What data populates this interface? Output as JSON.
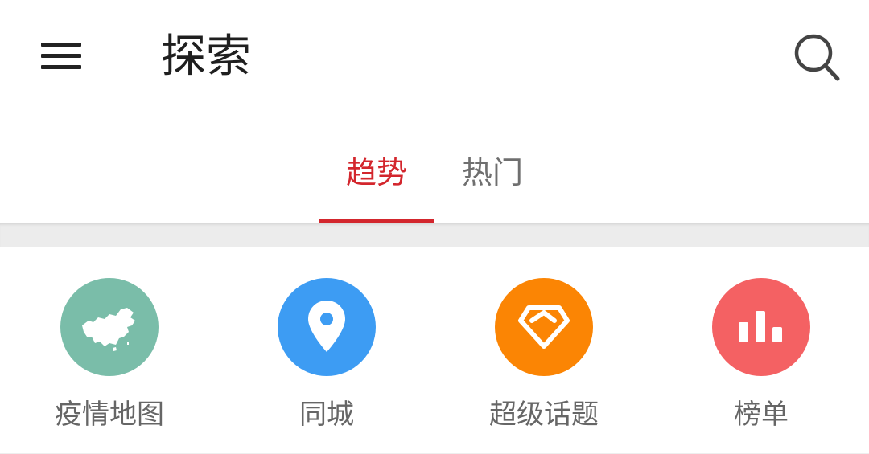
{
  "header": {
    "title": "探索",
    "menu_icon": "hamburger-menu-icon",
    "search_icon": "search-icon"
  },
  "tabs": [
    {
      "label": "趋势",
      "active": true
    },
    {
      "label": "热门",
      "active": false
    }
  ],
  "colors": {
    "accent": "#d3262d",
    "inactive_tab": "#6f6f6f",
    "separator": "#ececec"
  },
  "shortcuts": [
    {
      "label": "疫情地图",
      "icon": "china-map-icon",
      "color": "#7abda9"
    },
    {
      "label": "同城",
      "icon": "location-pin-icon",
      "color": "#3d9cf3"
    },
    {
      "label": "超级话题",
      "icon": "diamond-icon",
      "color": "#fb8504"
    },
    {
      "label": "榜单",
      "icon": "bar-chart-icon",
      "color": "#f46163"
    }
  ]
}
